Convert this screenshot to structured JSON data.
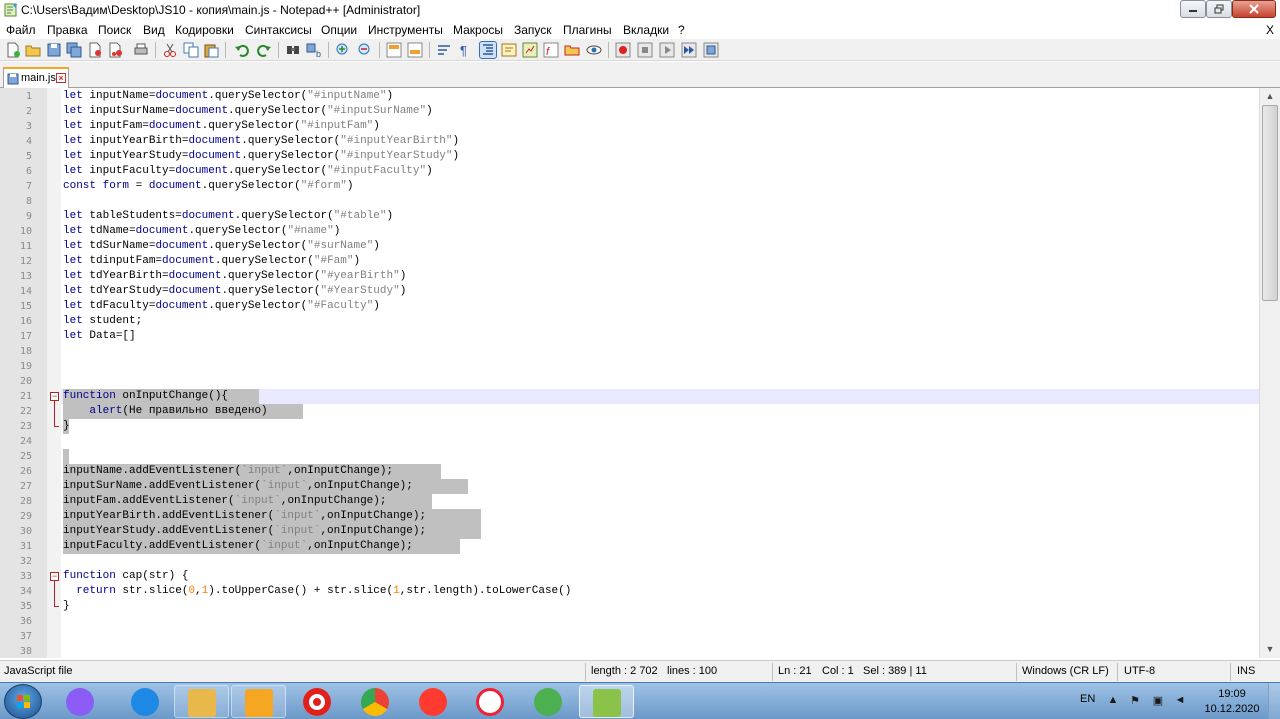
{
  "window": {
    "title": "C:\\Users\\Вадим\\Desktop\\JS10 - копия\\main.js - Notepad++ [Administrator]"
  },
  "menu": {
    "items": [
      "Файл",
      "Правка",
      "Поиск",
      "Вид",
      "Кодировки",
      "Синтаксисы",
      "Опции",
      "Инструменты",
      "Макросы",
      "Запуск",
      "Плагины",
      "Вкладки",
      "?"
    ],
    "close": "X"
  },
  "tab": {
    "label": "main.js"
  },
  "code": {
    "lines": [
      "let inputName=document.querySelector(\"#inputName\")",
      "let inputSurName=document.querySelector(\"#inputSurName\")",
      "let inputFam=document.querySelector(\"#inputFam\")",
      "let inputYearBirth=document.querySelector(\"#inputYearBirth\")",
      "let inputYearStudy=document.querySelector(\"#inputYearStudy\")",
      "let inputFaculty=document.querySelector(\"#inputFaculty\")",
      "const form = document.querySelector(\"#form\")",
      "",
      "let tableStudents=document.querySelector(\"#table\")",
      "let tdName=document.querySelector(\"#name\")",
      "let tdSurName=document.querySelector(\"#surName\")",
      "let tdinputFam=document.querySelector(\"#Fam\")",
      "let tdYearBirth=document.querySelector(\"#yearBirth\")",
      "let tdYearStudy=document.querySelector(\"#YearStudy\")",
      "let tdFaculty=document.querySelector(\"#Faculty\")",
      "let student;",
      "let Data=[]",
      "",
      "",
      "",
      "function onInputChange(){",
      "    alert(Не правильно введено)",
      "}",
      "",
      "",
      "inputName.addEventListener(`input`,onInputChange);",
      "inputSurName.addEventListener(`input`,onInputChange);",
      "inputFam.addEventListener(`input`,onInputChange);",
      "inputYearBirth.addEventListener(`input`,onInputChange);",
      "inputYearStudy.addEventListener(`input`,onInputChange);",
      "inputFaculty.addEventListener(`input`,onInputChange);",
      "",
      "function cap(str) {",
      "  return str.slice(0,1).toUpperCase() + str.slice(1,str.length).toLowerCase()",
      "}",
      "",
      "",
      ""
    ]
  },
  "status": {
    "file_type": "JavaScript file",
    "length": "length : 2 702",
    "lines": "lines : 100",
    "ln": "Ln : 21",
    "col": "Col : 1",
    "sel": "Sel : 389 | 11",
    "eol": "Windows (CR LF)",
    "encoding": "UTF-8",
    "mode": "INS"
  },
  "taskbar": {
    "apps": [
      {
        "name": "alice-icon",
        "color": "#8b5cf6"
      },
      {
        "name": "internet-explorer-icon",
        "color": "#1e88e5"
      },
      {
        "name": "file-explorer-icon",
        "color": "#e8b84a"
      },
      {
        "name": "media-player-icon",
        "color": "#f5a623"
      },
      {
        "name": "opera-icon",
        "color": "#e0201c"
      },
      {
        "name": "chrome-icon",
        "color": "#34a853"
      },
      {
        "name": "yandex-icon",
        "color": "#ff3b2f"
      },
      {
        "name": "yandex-browser-icon",
        "color": "#ffffff"
      },
      {
        "name": "utorrent-icon",
        "color": "#4caf50"
      },
      {
        "name": "notepadpp-icon",
        "color": "#8bc34a"
      }
    ],
    "lang": "EN",
    "time": "19:09",
    "date": "10.12.2020"
  },
  "colors": {
    "keyword": "#00008b",
    "string": "#808080",
    "number": "#ff8000",
    "selection": "#c0c0c0",
    "current_line": "#e8e8ff",
    "fold_marker": "#b22222"
  }
}
